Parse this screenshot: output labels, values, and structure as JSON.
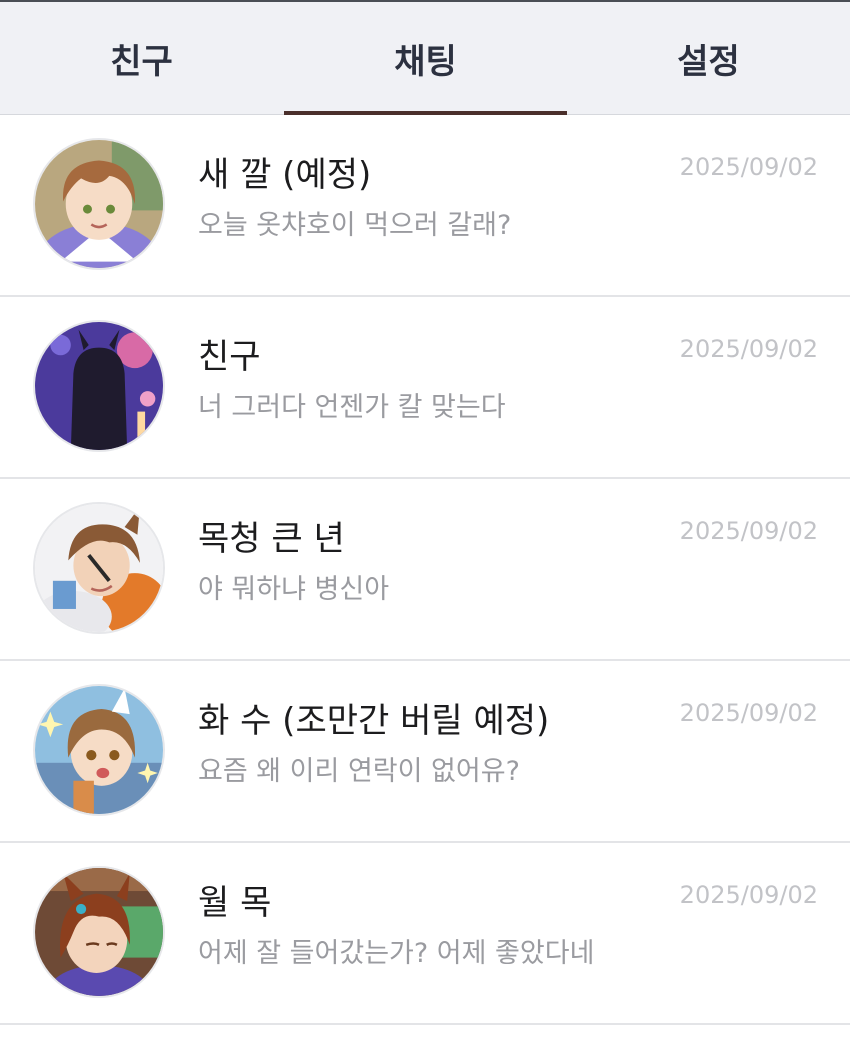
{
  "tabs": [
    {
      "label": "친구",
      "active": false
    },
    {
      "label": "채팅",
      "active": true
    },
    {
      "label": "설정",
      "active": false
    }
  ],
  "colors": {
    "tab_bar_bg": "#f0f1f5",
    "tab_text": "#2c3140",
    "active_indicator": "#4a2f2b",
    "name_text": "#1c1c1e",
    "preview_text": "#9a9ba0",
    "date_text": "#c2c3c7"
  },
  "chats": [
    {
      "name": "새 깔 (예정)",
      "preview": "오늘 옷챠호이 먹으러 갈래?",
      "date": "2025/09/02",
      "avatar": "avatar-brown-hair-purple-outfit"
    },
    {
      "name": "친구",
      "preview": "너 그러다 언젠가 칼 맞는다",
      "date": "2025/09/02",
      "avatar": "avatar-dark-hair-purple-night"
    },
    {
      "name": "목청 큰 년",
      "preview": "야 뭐하냐 병신아",
      "date": "2025/09/02",
      "avatar": "avatar-horse-ears-orange-jacket"
    },
    {
      "name": "화 수 (조만간 버릴 예정)",
      "preview": "요즘 왜 이리 연락이 없어유?",
      "date": "2025/09/02",
      "avatar": "avatar-brown-hair-sparkles"
    },
    {
      "name": "월 목",
      "preview": "어제 잘 들어갔는가? 어제 좋았다네",
      "date": "2025/09/02",
      "avatar": "avatar-chestnut-hair-cafe"
    }
  ]
}
